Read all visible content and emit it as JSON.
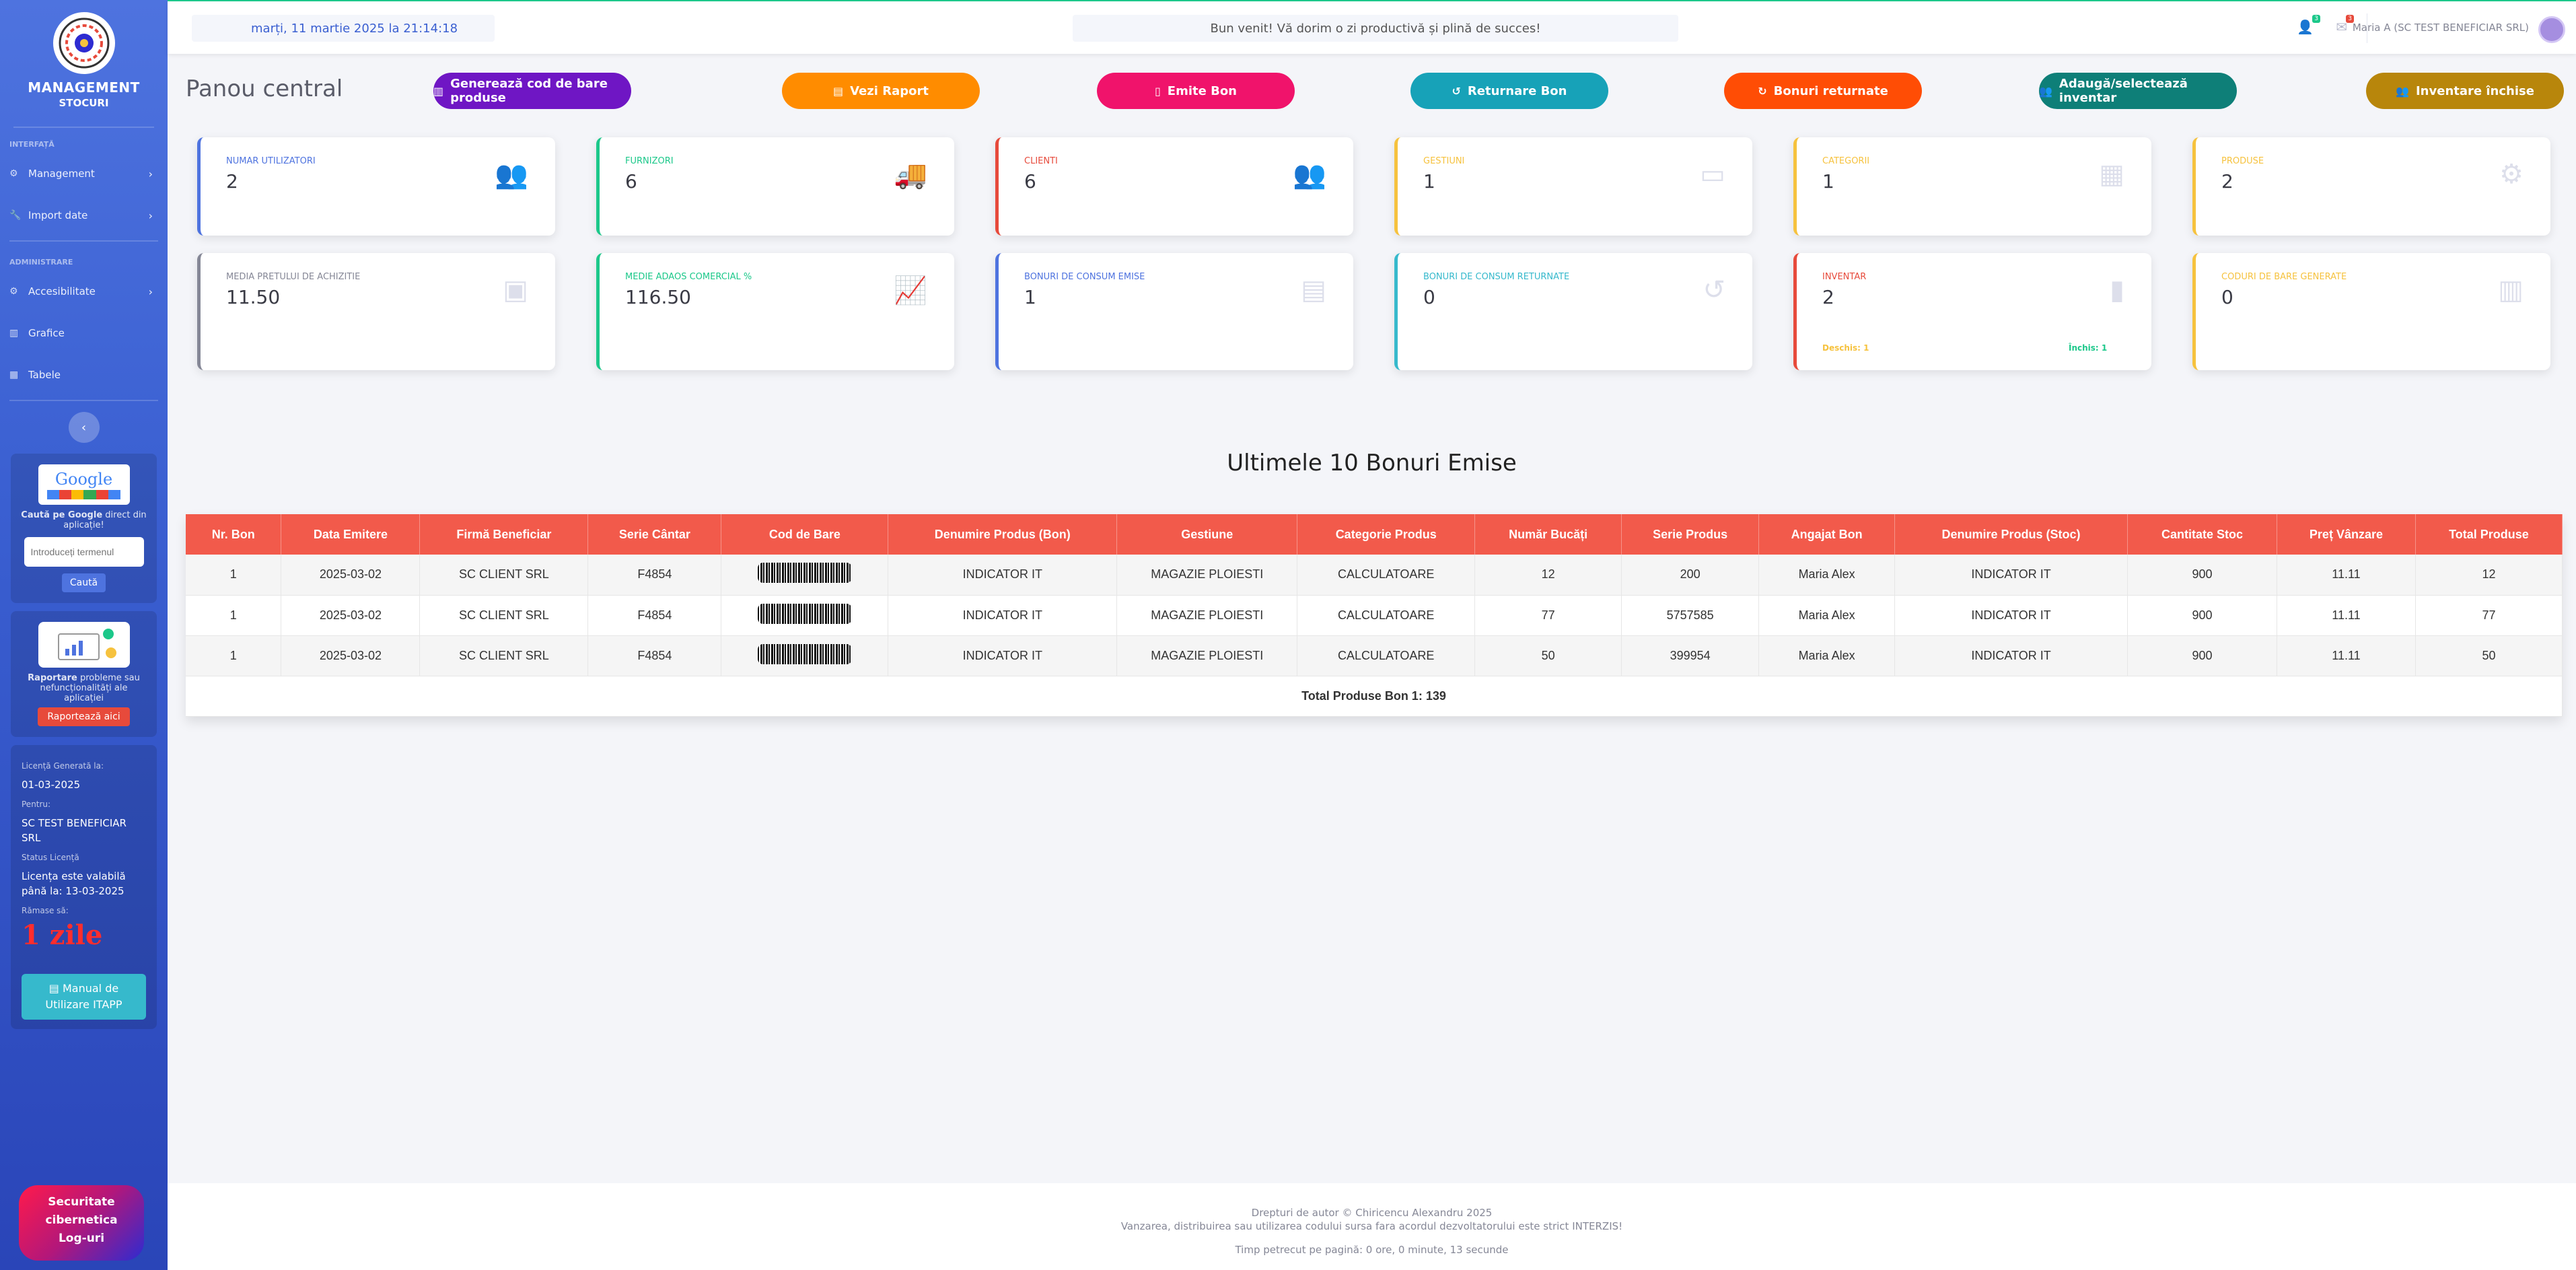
{
  "sidebar": {
    "brand_title": "MANAGEMENT",
    "brand_sub": "STOCURI",
    "heading_interfata": "INTERFAȚĂ",
    "heading_admin": "ADMINISTRARE",
    "items": [
      {
        "label": "Management",
        "icon": "gear-icon"
      },
      {
        "label": "Import date",
        "icon": "wrench-icon"
      },
      {
        "label": "Accesibilitate",
        "icon": "gear-icon"
      },
      {
        "label": "Grafice",
        "icon": "chart-icon"
      },
      {
        "label": "Tabele",
        "icon": "table-icon"
      }
    ],
    "google": {
      "logo_text": "Google",
      "text_bold": "Caută pe Google",
      "text_rest": " direct din aplicație!",
      "input_placeholder": "Introduceți termenul",
      "button": "Caută"
    },
    "report": {
      "text_bold": "Raportare",
      "text_rest": " probleme sau nefuncționalități ale aplicației",
      "button": "Raportează aici"
    },
    "license": {
      "generated_label": "Licență Generată la:",
      "generated_value": "01-03-2025",
      "for_label": "Pentru:",
      "for_value": "SC TEST BENEFICIAR SRL",
      "status_label": "Status Licență",
      "status_value": "Licența este valabilă până la: 13-03-2025",
      "remaining_label": "Rămase să:",
      "remaining_value": "1 zile",
      "manual_button": "Manual de Utilizare ITAPP"
    },
    "cyber": {
      "line1": "Securitate",
      "line2": "cibernetica",
      "line3": "Log-uri"
    }
  },
  "topbar": {
    "date": "marți, 11 martie 2025 la 21:14:18",
    "welcome": "Bun venit! Vă dorim o zi productivă și plină de succes!",
    "users_badge": "3",
    "alerts_badge": "3",
    "user": "Maria A  (SC TEST BENEFICIAR SRL)"
  },
  "main": {
    "title": "Panou central",
    "actions": [
      {
        "label": "Generează cod de bare produse",
        "color": "#6f16c4",
        "icon": "barcode-icon"
      },
      {
        "label": "Vezi Raport",
        "color": "#ff8c00",
        "icon": "file-icon"
      },
      {
        "label": "Emite Bon",
        "color": "#f0136b",
        "icon": "receipt-icon"
      },
      {
        "label": "Returnare Bon",
        "color": "#17a2b8",
        "icon": "undo-icon"
      },
      {
        "label": "Bonuri returnate",
        "color": "#ff4d05",
        "icon": "history-icon"
      },
      {
        "label": "Adaugă/selectează inventar",
        "color": "#0e7f78",
        "icon": "people-icon"
      },
      {
        "label": "Inventare închise",
        "color": "#b8860b",
        "icon": "people-icon"
      }
    ],
    "cards": [
      {
        "label": "NUMAR UTILIZATORI",
        "value": "2",
        "color": "#4e73df",
        "icon": "users-icon"
      },
      {
        "label": "FURNIZORI",
        "value": "6",
        "color": "#1cc88a",
        "icon": "truck-icon"
      },
      {
        "label": "CLIENTI",
        "value": "6",
        "color": "#e74a3b",
        "icon": "users-gear-icon"
      },
      {
        "label": "GESTIUNI",
        "value": "1",
        "color": "#f6c23e",
        "icon": "archive-icon"
      },
      {
        "label": "CATEGORII",
        "value": "1",
        "color": "#f6c23e",
        "icon": "grid-icon"
      },
      {
        "label": "PRODUSE",
        "value": "2",
        "color": "#f6c23e",
        "icon": "cogs-icon"
      },
      {
        "label": "MEDIA PRETULUI DE ACHIZITIE",
        "value": "11.50",
        "color": "#858796",
        "icon": "money-icon"
      },
      {
        "label": "MEDIE ADAOS COMERCIAL %",
        "value": "116.50",
        "color": "#1cc88a",
        "icon": "line-chart-icon"
      },
      {
        "label": "BONURI DE CONSUM EMISE",
        "value": "1",
        "color": "#4e73df",
        "icon": "document-icon"
      },
      {
        "label": "BONURI DE CONSUM RETURNATE",
        "value": "0",
        "color": "#36b9cc",
        "icon": "undo-icon"
      },
      {
        "label": "INVENTAR",
        "value": "2",
        "color": "#e74a3b",
        "icon": "clipboard-icon",
        "open_text": "Deschis: 1",
        "closed_text": "Închis: 1"
      },
      {
        "label": "CODURI DE BARE GENERATE",
        "value": "0",
        "color": "#f6c23e",
        "icon": "barcode-icon"
      }
    ],
    "section_title": "Ultimele 10 Bonuri Emise",
    "table": {
      "headers": [
        "Nr. Bon",
        "Data Emitere",
        "Firmă Beneficiar",
        "Serie Cântar",
        "Cod de Bare",
        "Denumire Produs (Bon)",
        "Gestiune",
        "Categorie Produs",
        "Număr Bucăți",
        "Serie Produs",
        "Angajat Bon",
        "Denumire Produs (Stoc)",
        "Cantitate Stoc",
        "Preț Vânzare",
        "Total Produse"
      ],
      "rows": [
        [
          "1",
          "2025-03-02",
          "SC CLIENT SRL",
          "F4854",
          "",
          "INDICATOR IT",
          "MAGAZIE PLOIESTI",
          "CALCULATOARE",
          "12",
          "200",
          "Maria Alex",
          "INDICATOR IT",
          "900",
          "11.11",
          "12"
        ],
        [
          "1",
          "2025-03-02",
          "SC CLIENT SRL",
          "F4854",
          "",
          "INDICATOR IT",
          "MAGAZIE PLOIESTI",
          "CALCULATOARE",
          "77",
          "5757585",
          "Maria Alex",
          "INDICATOR IT",
          "900",
          "11.11",
          "77"
        ],
        [
          "1",
          "2025-03-02",
          "SC CLIENT SRL",
          "F4854",
          "",
          "INDICATOR IT",
          "MAGAZIE PLOIESTI",
          "CALCULATOARE",
          "50",
          "399954",
          "Maria Alex",
          "INDICATOR IT",
          "900",
          "11.11",
          "50"
        ]
      ],
      "total": "Total Produse Bon 1: 139"
    }
  },
  "footer": {
    "line1": "Drepturi de autor © Chiricencu Alexandru 2025",
    "line2": "Vanzarea, distribuirea sau utilizarea codului sursa fara acordul dezvoltatorului este strict INTERZIS!",
    "line3": "Timp petrecut pe pagină: 0 ore, 0 minute, 13 secunde"
  }
}
